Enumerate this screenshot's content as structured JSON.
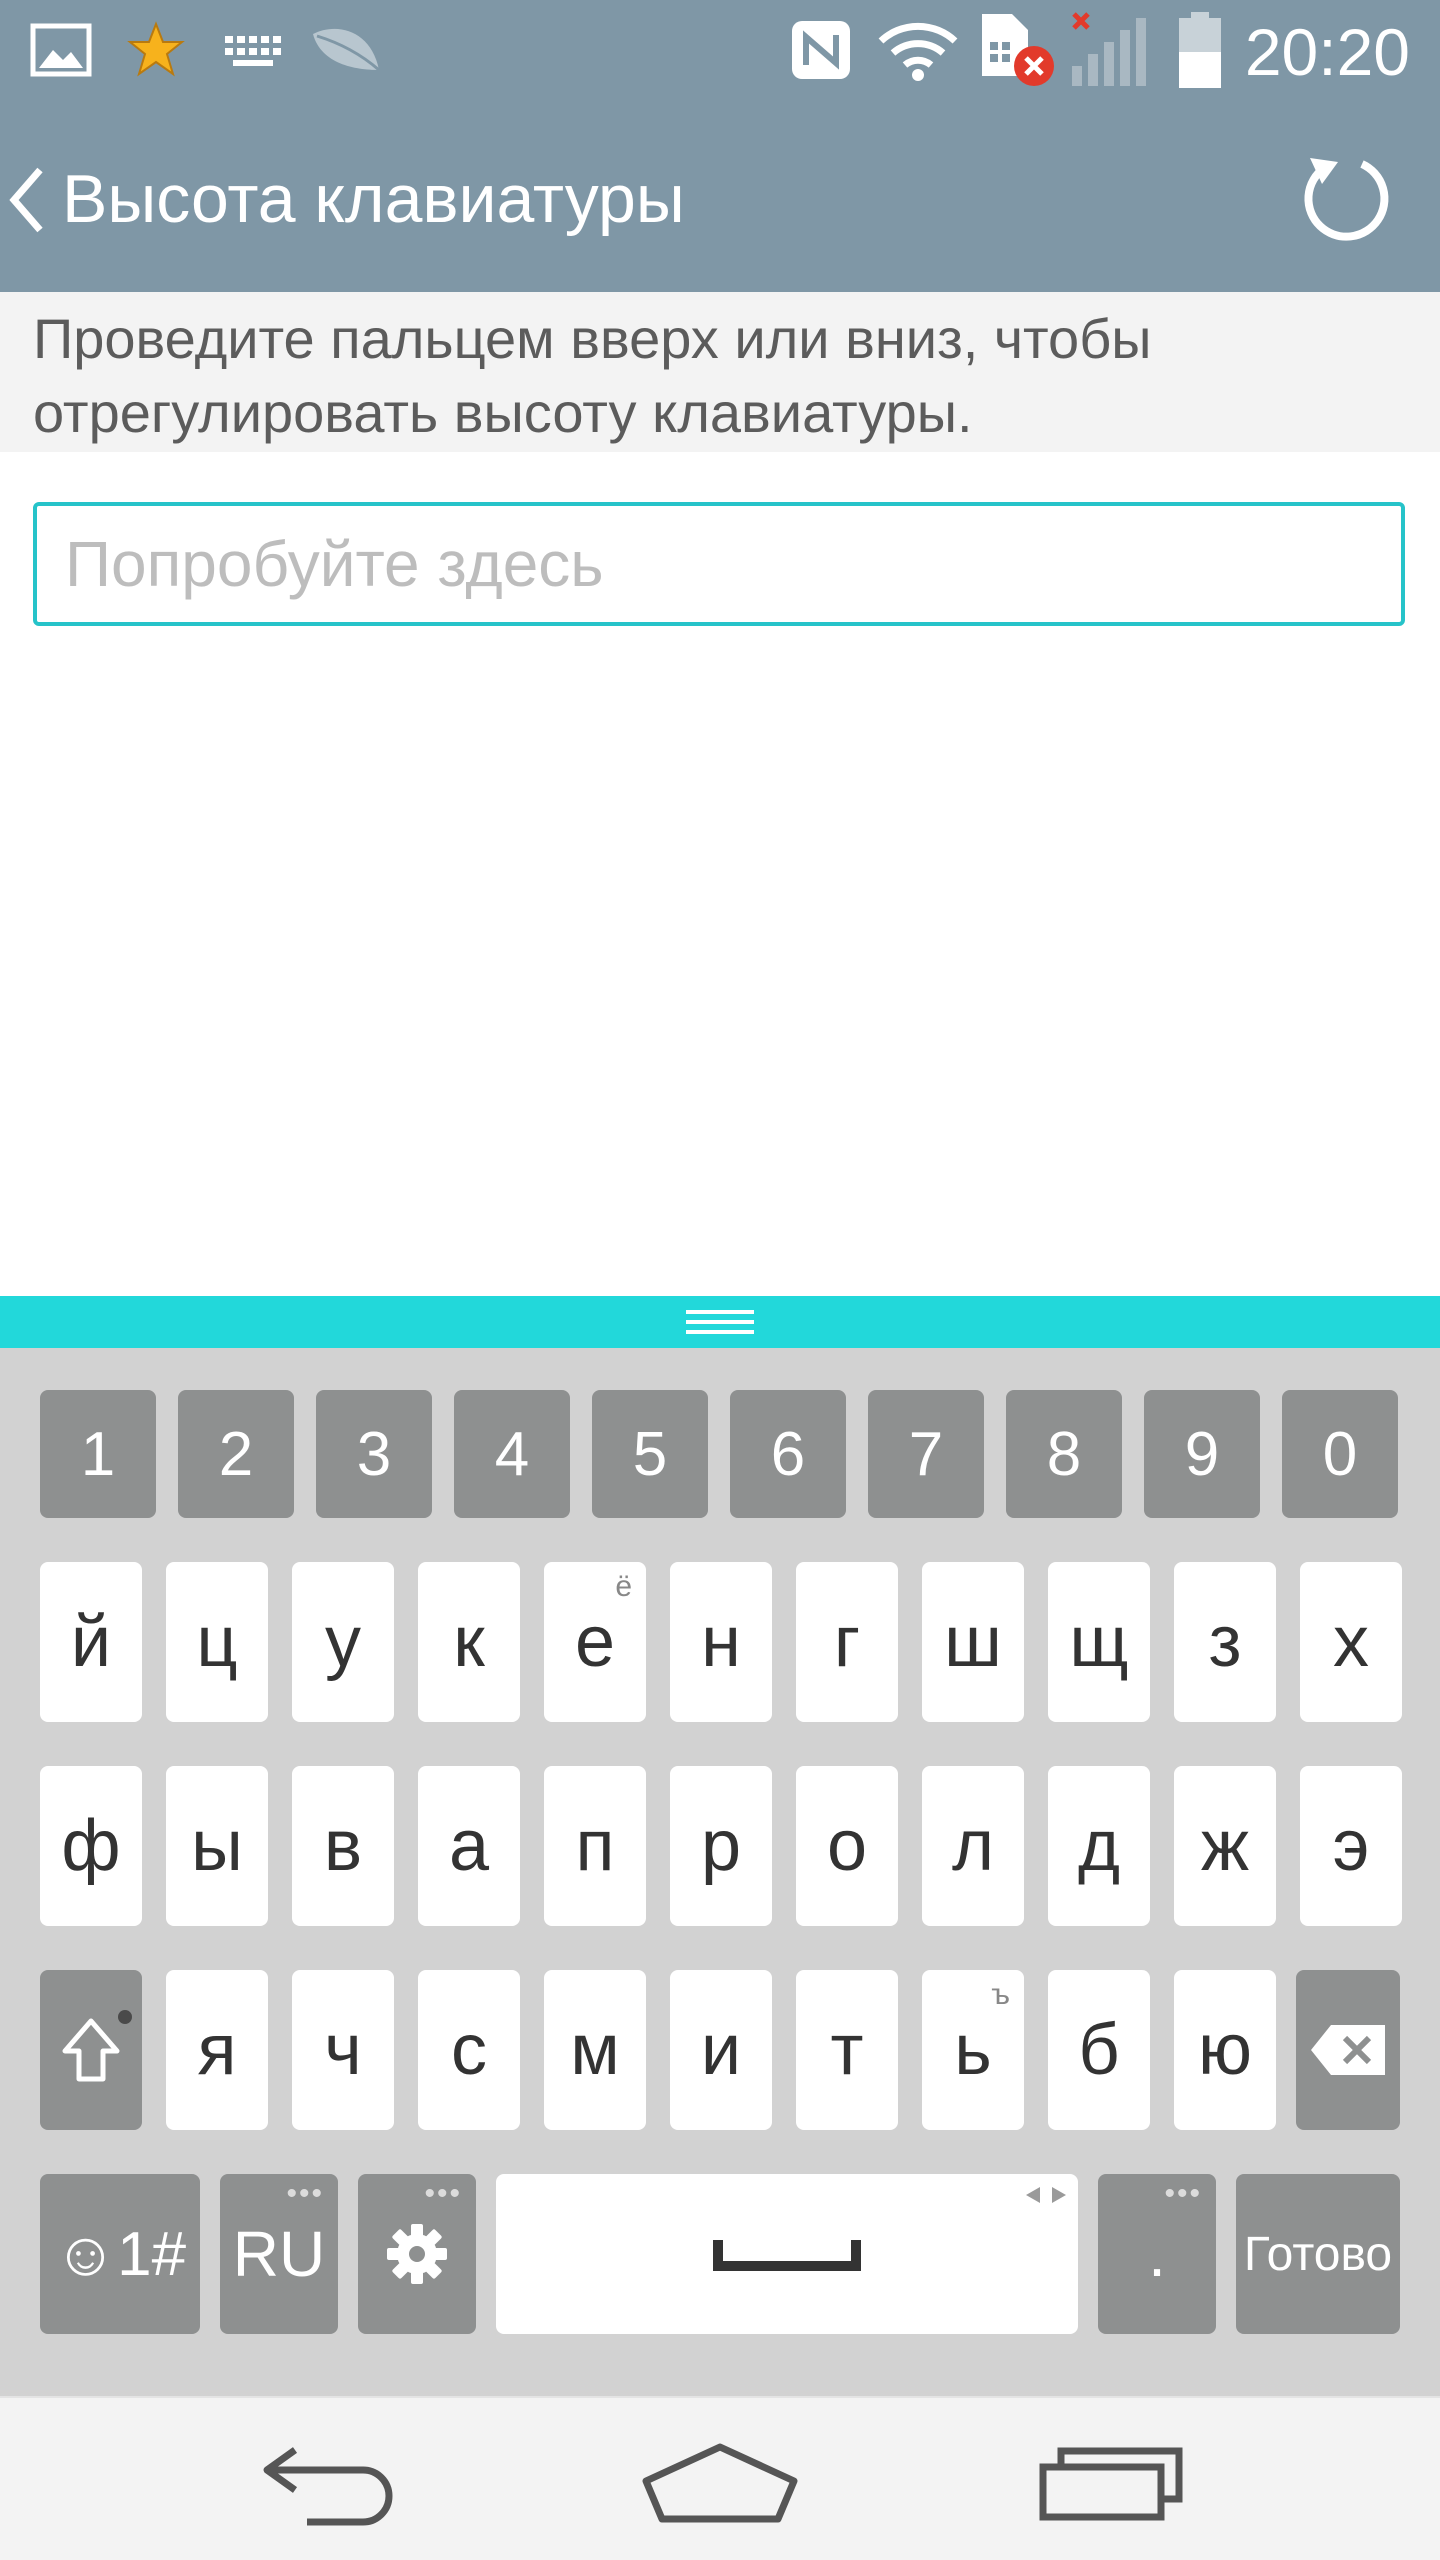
{
  "status_bar": {
    "time": "20:20",
    "icons": [
      "gallery-icon",
      "star-icon",
      "keyboard-icon",
      "leaf-icon",
      "nfc-icon",
      "wifi-icon",
      "sim-error-icon",
      "signal-no-service-icon",
      "battery-icon"
    ]
  },
  "action_bar": {
    "title": "Высота клавиатуры",
    "back_icon": "chevron-left-icon",
    "reset_icon": "reset-icon"
  },
  "instructions": {
    "line1": "Проведите пальцем вверх или вниз, чтобы",
    "line2": "отрегулировать высоту клавиатуры."
  },
  "try_input": {
    "placeholder": "Попробуйте здесь",
    "value": ""
  },
  "keyboard": {
    "accent_color": "#22d8da",
    "number_row": [
      "1",
      "2",
      "3",
      "4",
      "5",
      "6",
      "7",
      "8",
      "9",
      "0"
    ],
    "row1": [
      "й",
      "ц",
      "у",
      "к",
      "е",
      "н",
      "г",
      "ш",
      "щ",
      "з",
      "х"
    ],
    "row1_hint": "ё",
    "row2": [
      "ф",
      "ы",
      "в",
      "а",
      "п",
      "р",
      "о",
      "л",
      "д",
      "ж",
      "э"
    ],
    "row3": [
      "я",
      "ч",
      "с",
      "м",
      "и",
      "т",
      "ь",
      "б",
      "ю"
    ],
    "row3_hint": "ъ",
    "symbols_label": "☺1#",
    "language_label": "RU",
    "period_label": ".",
    "done_label": "Готово"
  },
  "nav_bar": {
    "icons": [
      "back-icon",
      "home-icon",
      "recents-icon"
    ]
  }
}
